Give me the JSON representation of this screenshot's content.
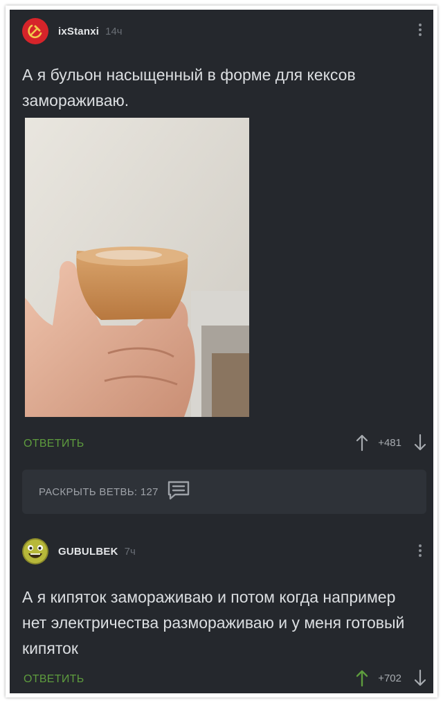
{
  "comments": [
    {
      "username": "ixStanxi",
      "time": "14ч",
      "text": "А я бульон насыщенный в форме для кексов замораживаю.",
      "reply_label": "ОТВЕТИТЬ",
      "rating": "+481",
      "avatar_icon": "hammer-sickle-icon"
    },
    {
      "username": "GUBULBEK",
      "time": "7ч",
      "text": "А я кипяток замораживаю и потом когда например нет электричества размораживаю и у меня готовый кипяток",
      "reply_label": "ОТВЕТИТЬ",
      "rating": "+702",
      "avatar_icon": "smiley-icon"
    }
  ],
  "thread": {
    "expand_label": "РАСКРЫТЬ ВЕТВЬ: 127"
  },
  "colors": {
    "background": "#25282d",
    "accent_green": "#5e9c3e",
    "text": "#dcdfe2",
    "muted": "#6a6f76"
  }
}
